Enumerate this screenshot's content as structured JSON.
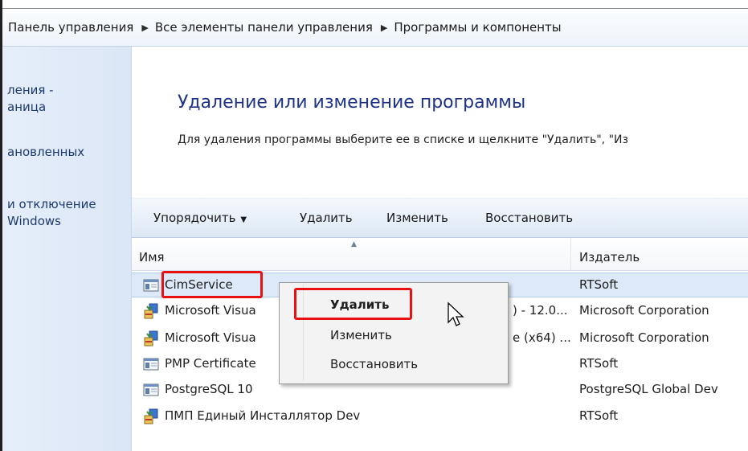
{
  "breadcrumb": {
    "items": [
      "Панель управления",
      "Все элементы панели управления",
      "Программы и компоненты"
    ],
    "separator": "▶"
  },
  "sidebar": {
    "links": [
      {
        "lines": [
          "ления -",
          "аница"
        ]
      },
      {
        "lines": [
          "ановленных"
        ]
      },
      {
        "lines": [
          "и отключение",
          "Windows"
        ]
      }
    ]
  },
  "main": {
    "title": "Удаление или изменение программы",
    "description": "Для удаления программы выберите ее в списке и щелкните \"Удалить\", \"Из"
  },
  "toolbar": {
    "organize_label": "Упорядочить",
    "organize_arrow": "▼",
    "uninstall_label": "Удалить",
    "change_label": "Изменить",
    "repair_label": "Восстановить"
  },
  "table": {
    "columns": {
      "name": "Имя",
      "publisher": "Издатель"
    },
    "sort_indicator": "▲",
    "rows": [
      {
        "name": "CimService",
        "version": "",
        "publisher": "RTSoft",
        "icon": "program-icon",
        "selected": true
      },
      {
        "name": "Microsoft Visua",
        "version": ") - 12.0...",
        "publisher": "Microsoft Corporation",
        "icon": "installer-icon",
        "selected": false
      },
      {
        "name": "Microsoft Visua",
        "version": "e (x64) ...",
        "publisher": "Microsoft Corporation",
        "icon": "installer-icon",
        "selected": false
      },
      {
        "name": "PMP Certificate",
        "version": "",
        "publisher": "RTSoft",
        "icon": "program-icon",
        "selected": false
      },
      {
        "name": "PostgreSQL 10",
        "version": "",
        "publisher": "PostgreSQL Global Dev",
        "icon": "program-icon",
        "selected": false
      },
      {
        "name": "ПМП Единый Инсталлятор Dev",
        "version": "",
        "publisher": "RTSoft",
        "icon": "installer-icon",
        "selected": false
      }
    ]
  },
  "context_menu": {
    "items": [
      {
        "label": "Удалить",
        "bold": true
      },
      {
        "label": "Изменить",
        "bold": false
      },
      {
        "label": "Восстановить",
        "bold": false
      }
    ]
  },
  "colors": {
    "highlight": "#e81010",
    "title": "#1e3287",
    "sidebar_link": "#1c3a70",
    "selected_row": "#dde9f8"
  }
}
